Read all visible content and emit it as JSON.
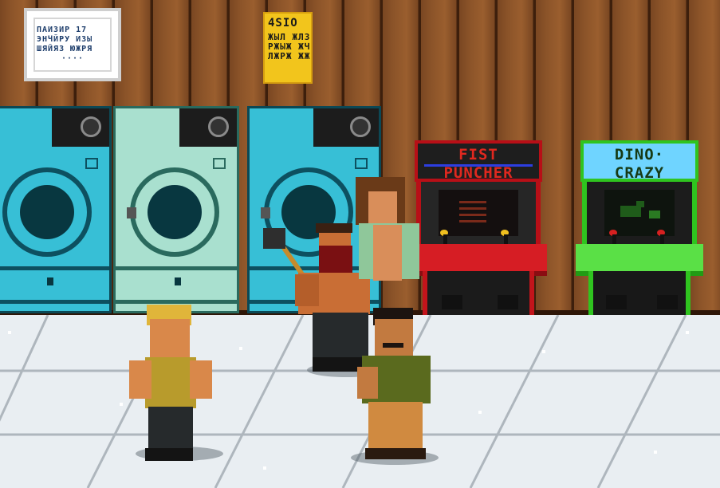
{
  "posters": {
    "white": {
      "line1": "ПАИЗИР 17",
      "line2": "ЭНЧЙРУ ИЗЫ",
      "line3": "ШЯЙЯЗ ЮЖРЯ",
      "line4": "····"
    },
    "yellow": {
      "title": "4SIO",
      "line1": "ЖЫЛ ЖЛЗ",
      "line2": "РЖЫЖ ЖЧ",
      "line3": "ЛЖРЖ ЖЖ"
    }
  },
  "arcades": [
    {
      "id": "fist",
      "line1": "FIST",
      "line2": "PUNCHER"
    },
    {
      "id": "dino",
      "line1": "DINO·",
      "line2": "CRAZY"
    }
  ],
  "colors": {
    "washer_teal": "#37bfd6",
    "washer_mint": "#a9e0cf",
    "fist_red": "#d61d24",
    "dino_green": "#2fc41f"
  }
}
